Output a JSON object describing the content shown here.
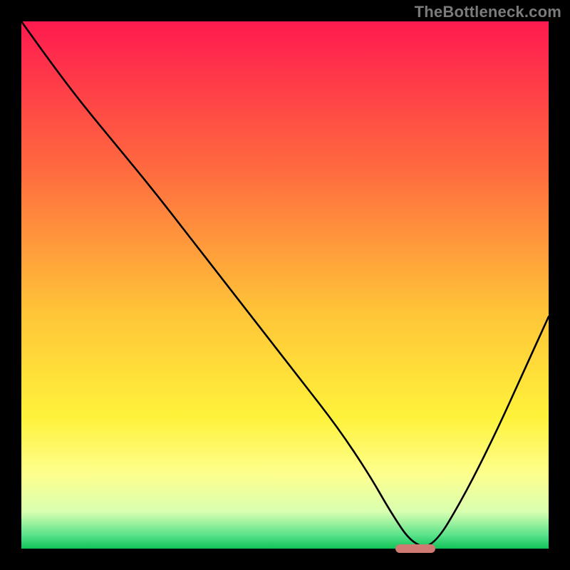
{
  "watermark": "TheBottleneck.com",
  "chart_data": {
    "type": "line",
    "title": "",
    "xlabel": "",
    "ylabel": "",
    "xlim": [
      0,
      100
    ],
    "ylim": [
      0,
      100
    ],
    "grid": false,
    "legend": false,
    "gradient_stops": [
      {
        "pct": 0,
        "color": "#ff1a4f"
      },
      {
        "pct": 28,
        "color": "#ff6a3f"
      },
      {
        "pct": 55,
        "color": "#ffc438"
      },
      {
        "pct": 75,
        "color": "#fff23a"
      },
      {
        "pct": 86,
        "color": "#fdff8f"
      },
      {
        "pct": 93,
        "color": "#d9ffb0"
      },
      {
        "pct": 97.5,
        "color": "#58e28a"
      },
      {
        "pct": 100,
        "color": "#10c257"
      }
    ],
    "series": [
      {
        "name": "bottleneck-curve",
        "x": [
          0,
          5,
          11,
          18,
          25,
          32,
          39,
          46,
          53,
          60,
          66,
          70,
          74,
          78,
          84,
          90,
          95,
          100
        ],
        "y": [
          100,
          93,
          85,
          76.5,
          68,
          59,
          50,
          41,
          32,
          23,
          14,
          7,
          1,
          0,
          10,
          22,
          33,
          44
        ]
      }
    ],
    "marker": {
      "x_start": 71,
      "x_end": 78.5,
      "y": 0,
      "color": "#cf7a72"
    },
    "annotations": []
  }
}
